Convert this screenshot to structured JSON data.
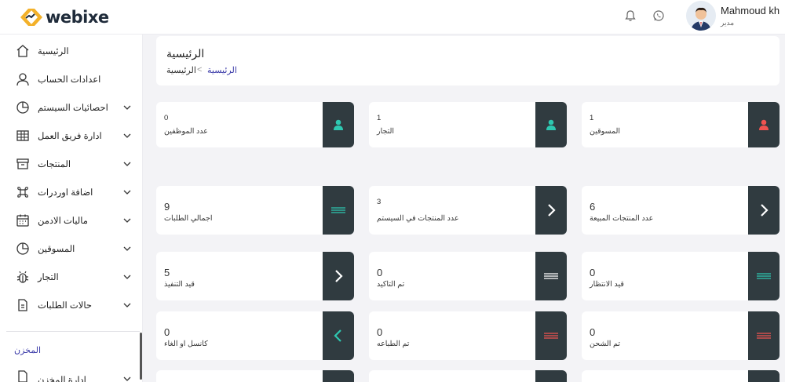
{
  "brand": {
    "name": "webixe"
  },
  "header": {
    "user_name": "Mahmoud kh",
    "user_role": "مدير",
    "icons": [
      "bell-icon",
      "whatsapp-icon"
    ]
  },
  "sidebar": {
    "items": [
      {
        "label": "الرئيسية",
        "icon": "home-icon",
        "expandable": false
      },
      {
        "label": "اعدادات الحساب",
        "icon": "user-icon",
        "expandable": false
      },
      {
        "label": "احصائيات السيستم",
        "icon": "pie-chart-icon",
        "expandable": true
      },
      {
        "label": "ادارة فريق العمل",
        "icon": "table-icon",
        "expandable": true
      },
      {
        "label": "المنتجات",
        "icon": "archive-icon",
        "expandable": true
      },
      {
        "label": "اضافة اوردرات",
        "icon": "command-icon",
        "expandable": true
      },
      {
        "label": "ماليات الادمن",
        "icon": "calendar-icon",
        "expandable": true
      },
      {
        "label": "المسوقين",
        "icon": "pie-chart-icon",
        "expandable": true
      },
      {
        "label": "التجار",
        "icon": "bug-icon",
        "expandable": true
      },
      {
        "label": "حالات الطلبات",
        "icon": "file-icon",
        "expandable": true
      }
    ],
    "section_title": "المخزن",
    "partial_item": "ادارة المخزن"
  },
  "page": {
    "title": "الرئيسية",
    "breadcrumb": {
      "home": "الرئيسية",
      "current": "الرئيسية",
      "separator": "<"
    }
  },
  "stats": {
    "row1": [
      {
        "value": "0",
        "label": "عدد الموظفين",
        "icon": "person-icon",
        "icon_color": "#2ec7b0"
      },
      {
        "value": "1",
        "label": "التجار",
        "icon": "person-icon",
        "icon_color": "#2ec7b0"
      },
      {
        "value": "1",
        "label": "المسوقين",
        "icon": "person-icon",
        "icon_color": "#ef5350"
      }
    ],
    "row2": [
      {
        "value": "9",
        "label": "اجمالي الطلبات",
        "icon": "list-icon",
        "icon_color": "#2ec7b0"
      },
      {
        "value": "3",
        "label": "عدد المنتجات في السيستم",
        "icon": "chevron-right-icon",
        "icon_color": "#ffffff"
      },
      {
        "value": "6",
        "label": "عدد المنتجات المبيعة",
        "icon": "chevron-right-icon",
        "icon_color": "#ffffff"
      }
    ],
    "row3": [
      {
        "value": "5",
        "label": "قيد التنفيذ",
        "icon": "chevron-right-icon",
        "icon_color": "#ffffff"
      },
      {
        "value": "0",
        "label": "تم التاكيد",
        "icon": "list-icon",
        "icon_color": "#ffffff"
      },
      {
        "value": "0",
        "label": "قيد الانتظار",
        "icon": "list-icon",
        "icon_color": "#2ec7b0"
      }
    ],
    "row4": [
      {
        "value": "0",
        "label": "كانسل او الغاء",
        "icon": "chevron-left-icon",
        "icon_color": "#2ec7b0"
      },
      {
        "value": "0",
        "label": "تم الطباعه",
        "icon": "list-icon",
        "icon_color": "#ef5350"
      },
      {
        "value": "0",
        "label": "تم الشحن",
        "icon": "list-icon",
        "icon_color": "#ef5350"
      }
    ]
  },
  "colors": {
    "accent": "#3a3aa8",
    "card_side": "#303b40",
    "teal": "#2ec7b0",
    "red": "#ef5350"
  }
}
